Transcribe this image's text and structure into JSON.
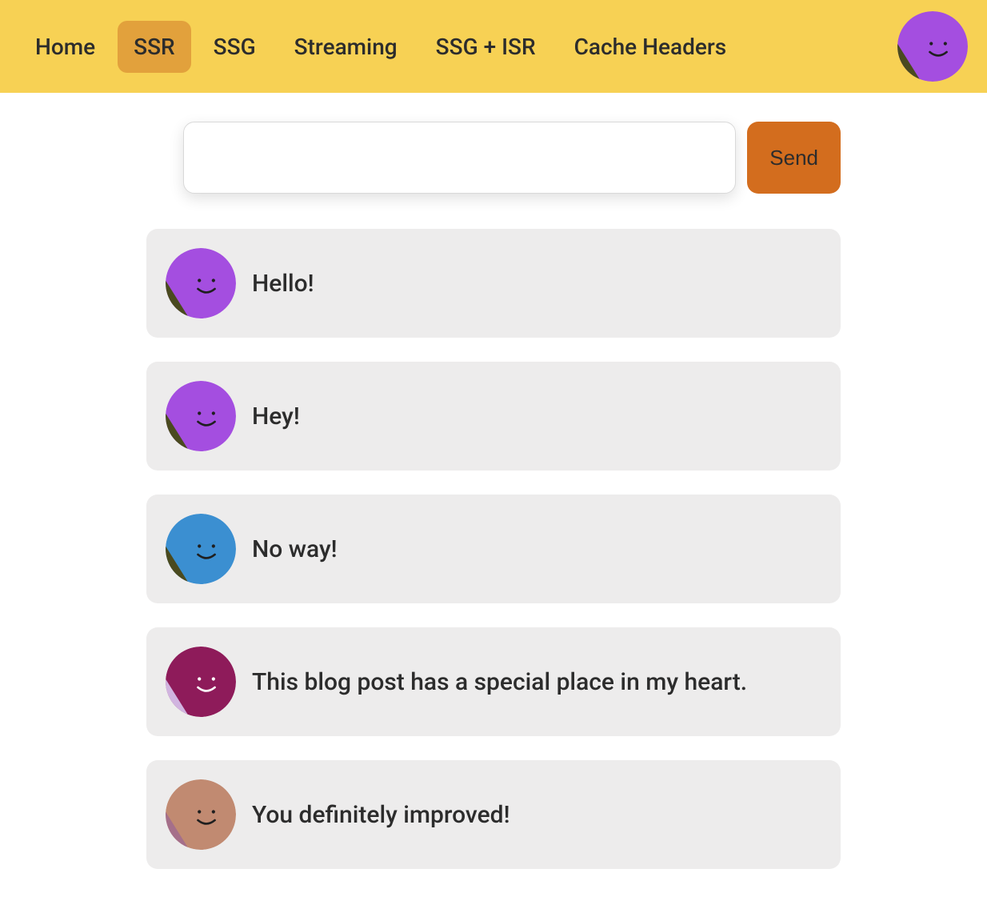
{
  "nav": {
    "items": [
      {
        "label": "Home",
        "active": false
      },
      {
        "label": "SSR",
        "active": true
      },
      {
        "label": "SSG",
        "active": false
      },
      {
        "label": "Streaming",
        "active": false
      },
      {
        "label": "SSG + ISR",
        "active": false
      },
      {
        "label": "Cache Headers",
        "active": false
      }
    ]
  },
  "header_avatar": {
    "bg": "#a44ee0",
    "accent": "#4a4a1f",
    "face": "dark"
  },
  "compose": {
    "value": "",
    "send_label": "Send"
  },
  "messages": [
    {
      "text": "Hello!",
      "avatar": {
        "bg": "#a44ee0",
        "accent": "#4a4a1f",
        "face": "dark"
      }
    },
    {
      "text": "Hey!",
      "avatar": {
        "bg": "#a44ee0",
        "accent": "#4a4a1f",
        "face": "dark"
      }
    },
    {
      "text": "No way!",
      "avatar": {
        "bg": "#3b8fd1",
        "accent": "#4a4a1f",
        "face": "dark"
      }
    },
    {
      "text": "This blog post has a special place in my heart.",
      "avatar": {
        "bg": "#8e1b5a",
        "accent": "#d1b4e0",
        "face": "light"
      }
    },
    {
      "text": "You definitely improved!",
      "avatar": {
        "bg": "#c18a71",
        "accent": "#a56f8a",
        "face": "dark"
      }
    }
  ]
}
